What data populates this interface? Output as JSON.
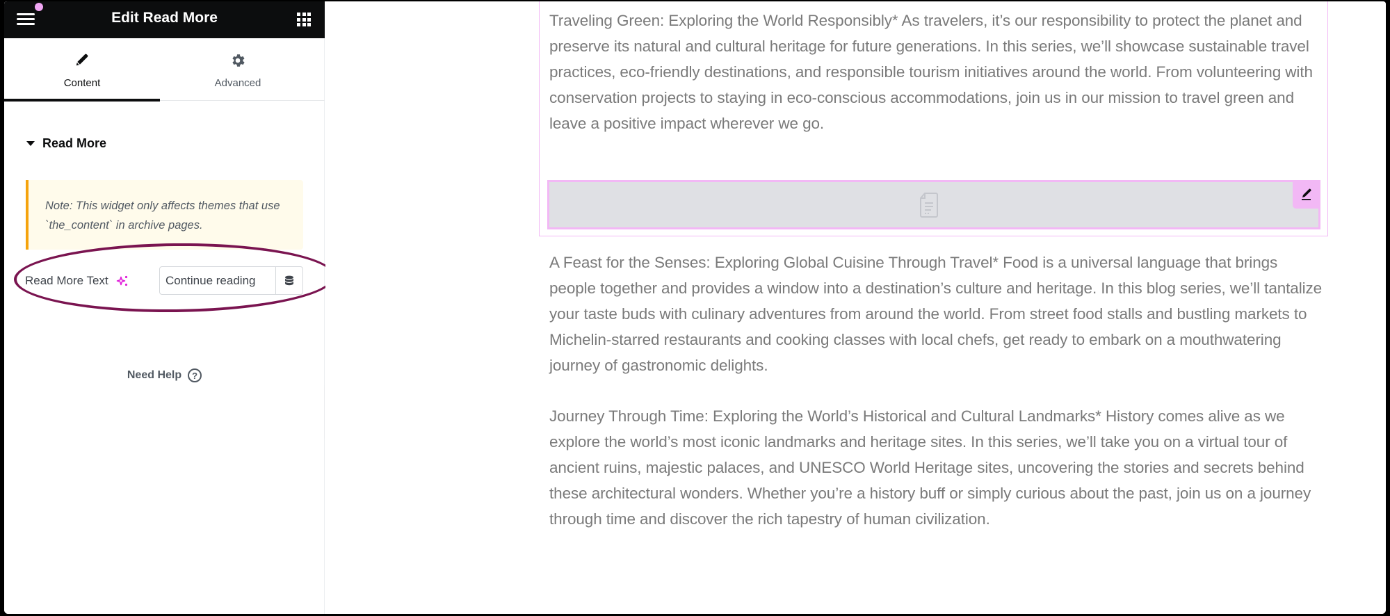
{
  "panel": {
    "title": "Edit Read More",
    "menu_icon": "hamburger-menu-icon",
    "apps_icon": "grid-apps-icon",
    "tabs": [
      {
        "label": "Content",
        "icon": "pencil-icon",
        "active": true
      },
      {
        "label": "Advanced",
        "icon": "gear-icon",
        "active": false
      }
    ],
    "section": {
      "title": "Read More",
      "expanded": true
    },
    "note": "Note: This widget only affects themes that use `the_content` in archive pages.",
    "control": {
      "label": "Read More Text",
      "ai_icon": "sparkle-ai-icon",
      "value": "Continue reading",
      "dynamic_icon": "database-dynamic-tags-icon"
    },
    "help_label": "Need Help",
    "help_icon": "question-circle-icon",
    "collapse_icon": "chevron-left-icon"
  },
  "preview": {
    "paragraphs": [
      "Traveling Green: Exploring the World Responsibly* As travelers, it’s our responsibility to protect the planet and preserve its natural and cultural heritage for future generations. In this series, we’ll showcase sustainable travel practices, eco-friendly destinations, and responsible tourism initiatives around the world. From volunteering with conservation projects to staying in eco-conscious accommodations, join us in our mission to travel green and leave a positive impact wherever we go.",
      "A Feast for the Senses: Exploring Global Cuisine Through Travel* Food is a universal language that brings people together and provides a window into a destination’s culture and heritage. In this blog series, we’ll tantalize your taste buds with culinary adventures from around the world. From street food stalls and bustling markets to Michelin-starred restaurants and cooking classes with local chefs, get ready to embark on a mouthwatering journey of gastronomic delights.",
      "Journey Through Time: Exploring the World’s Historical and Cultural Landmarks* History comes alive as we explore the world’s most iconic landmarks and heritage sites. In this series, we’ll take you on a virtual tour of ancient ruins, majestic palaces, and UNESCO World Heritage sites, uncovering the stories and secrets behind these architectural wonders. Whether you’re a history buff or simply curious about the past, join us on a journey through time and discover the rich tapestry of human civilization."
    ],
    "placeholder_icon": "document-icon",
    "edit_icon": "pencil-edit-icon"
  },
  "colors": {
    "header_bg": "#0c0d0e",
    "accent_pink": "#f2b8f5",
    "note_border": "#f5a30c",
    "note_bg": "#fffbeb",
    "highlight_ellipse": "#7a1450",
    "ai_sparkle": "#e01fd9",
    "body_text": "#7a7a7a"
  }
}
